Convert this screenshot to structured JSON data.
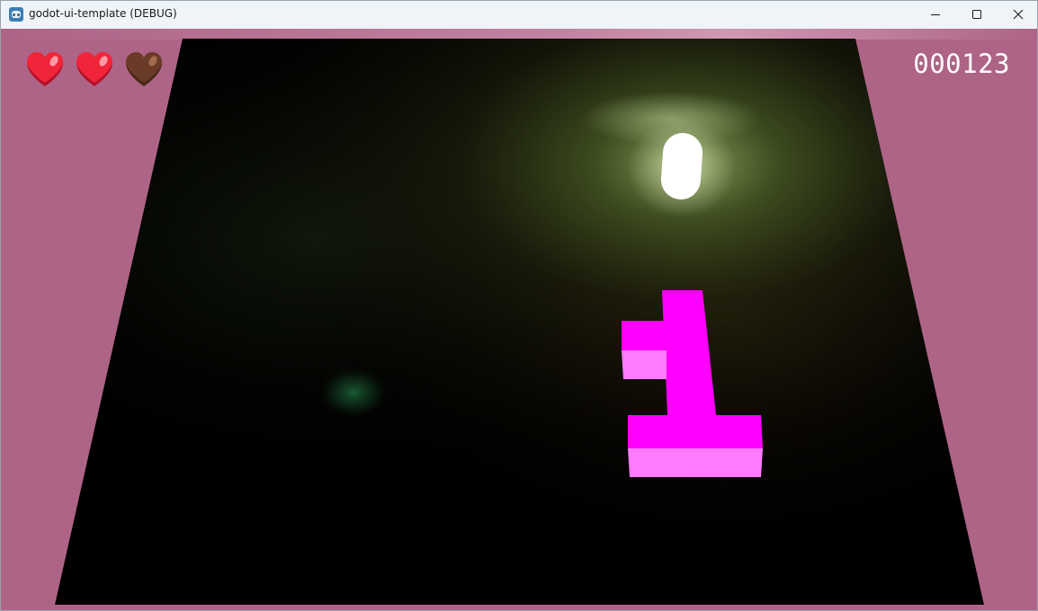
{
  "window": {
    "title": "godot-ui-template (DEBUG)",
    "app_icon": "godot-icon",
    "controls": [
      "minimize-icon",
      "maximize-icon",
      "close-icon"
    ]
  },
  "hud": {
    "lives_total": 3,
    "lives_remaining": 2,
    "hearts": [
      {
        "state": "full",
        "color": "#f0253a"
      },
      {
        "state": "full",
        "color": "#f0253a"
      },
      {
        "state": "empty",
        "color": "#6a3b26"
      }
    ],
    "score": "000123"
  },
  "scene": {
    "background_color": "#ad6487",
    "floor_color": "#000000",
    "player_color": "#ffffff",
    "block_color": "#ff00ff",
    "block_highlight_color": "#ff7aff",
    "light_glow_color": "#c8e09a",
    "green_glow_color": "#1e6a3a"
  }
}
